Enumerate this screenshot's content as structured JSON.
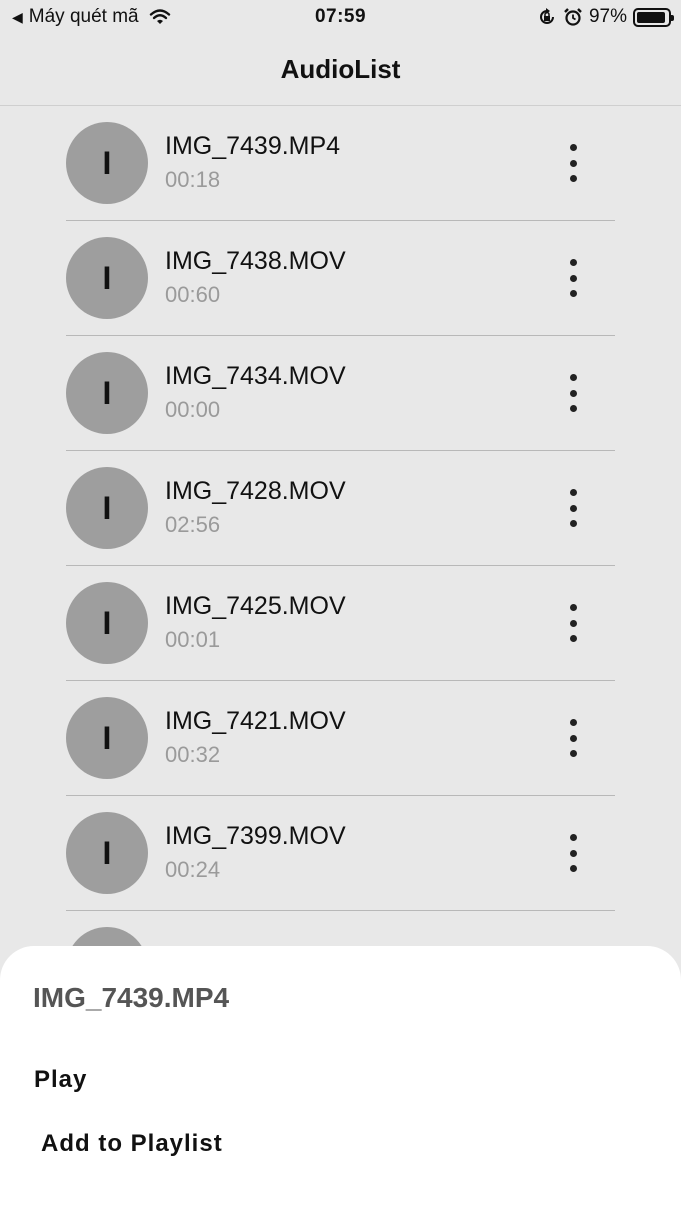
{
  "status_bar": {
    "back_label": "Máy quét mã",
    "time": "07:59",
    "battery": "97%",
    "icons": [
      "back-triangle-icon",
      "wifi-icon",
      "rotation-lock-icon",
      "alarm-icon",
      "battery-icon"
    ]
  },
  "nav": {
    "title": "AudioList"
  },
  "audio_list": [
    {
      "avatar": "I",
      "title": "IMG_7439.MP4",
      "duration": "00:18"
    },
    {
      "avatar": "I",
      "title": "IMG_7438.MOV",
      "duration": "00:60"
    },
    {
      "avatar": "I",
      "title": "IMG_7434.MOV",
      "duration": "00:00"
    },
    {
      "avatar": "I",
      "title": "IMG_7428.MOV",
      "duration": "02:56"
    },
    {
      "avatar": "I",
      "title": "IMG_7425.MOV",
      "duration": "00:01"
    },
    {
      "avatar": "I",
      "title": "IMG_7421.MOV",
      "duration": "00:32"
    },
    {
      "avatar": "I",
      "title": "IMG_7399.MOV",
      "duration": "00:24"
    }
  ],
  "sheet": {
    "title": "IMG_7439.MP4",
    "play_label": "Play",
    "add_label": "Add to Playlist"
  },
  "colors": {
    "background": "#e8e8e8",
    "avatar": "#9e9e9e",
    "duration_text": "#9a9a9a",
    "sheet": "#ffffff"
  }
}
